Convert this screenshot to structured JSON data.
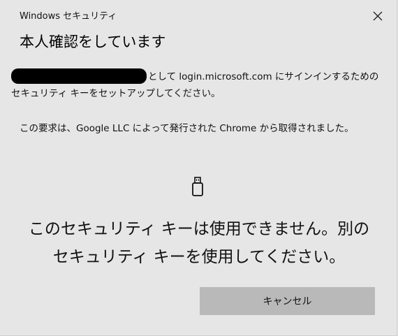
{
  "window": {
    "title": "Windows セキュリティ"
  },
  "dialog": {
    "heading": "本人確認をしています",
    "paragraph1": "として login.microsoft.com にサインインするためのセキュリティ キーをセットアップしてください。",
    "paragraph2": "この要求は、Google LLC によって発行された Chrome から取得されました。",
    "message_line1": "このセキュリティ キーは使用できません。別の",
    "message_line2": "セキュリティ キーを使用してください。",
    "cancel_label": "キャンセル"
  },
  "icons": {
    "close": "close-icon",
    "key": "usb-security-key-icon"
  }
}
